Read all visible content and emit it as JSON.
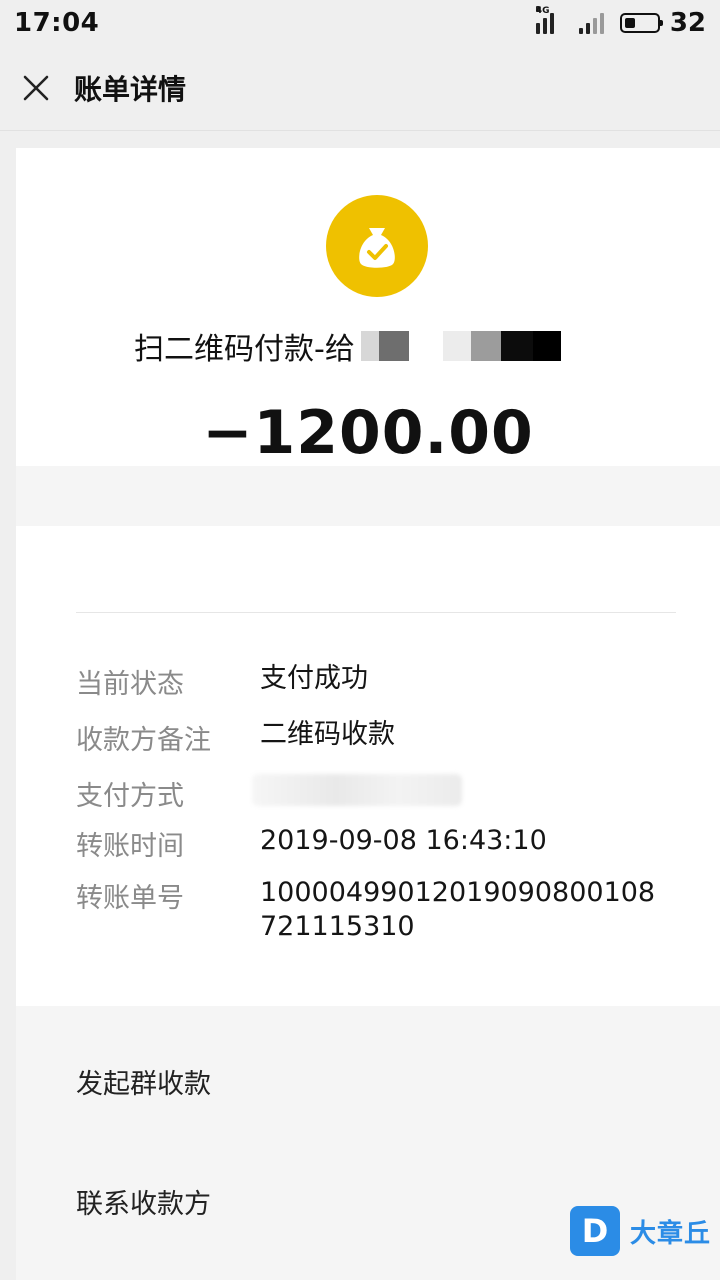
{
  "status_bar": {
    "time": "17:04",
    "network": "4G",
    "battery": "32"
  },
  "header": {
    "title": "账单详情",
    "close_icon": "close-icon"
  },
  "transaction": {
    "icon": "money-bag-check-icon",
    "icon_color": "#efc100",
    "merchant_prefix": "扫二维码付款-给",
    "amount": "−1200.00"
  },
  "details": [
    {
      "label": "当前状态",
      "value": "支付成功"
    },
    {
      "label": "收款方备注",
      "value": "二维码收款"
    },
    {
      "label": "支付方式",
      "value": ""
    },
    {
      "label": "转账时间",
      "value": "2019-09-08 16:43:10"
    },
    {
      "label": "转账单号",
      "value": "10000499012019090800108721115310"
    }
  ],
  "actions": {
    "group_collect": "发起群收款",
    "contact_payee": "联系收款方"
  },
  "watermark": {
    "logo_letter": "D",
    "text": "大章丘"
  }
}
